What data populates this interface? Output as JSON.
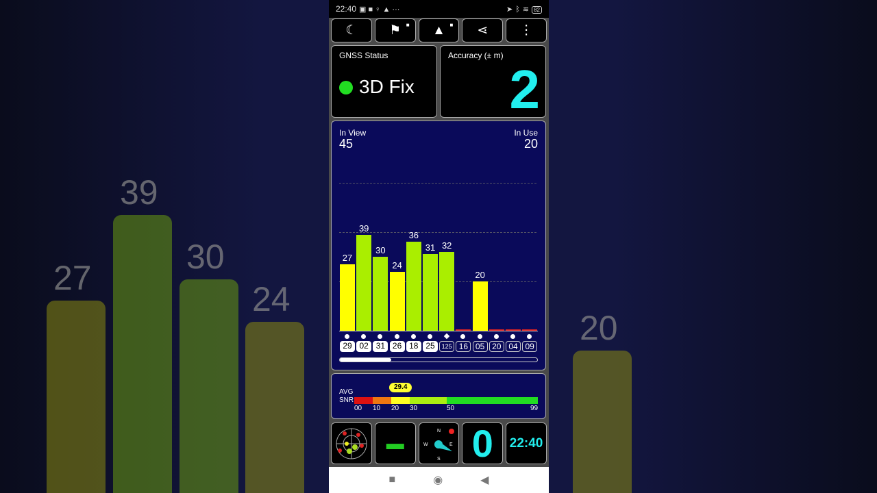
{
  "status_bar": {
    "time": "22:40",
    "battery": "82"
  },
  "toolbar": {
    "buttons": [
      {
        "icon": "moon-icon"
      },
      {
        "icon": "person-flag-icon",
        "locked": true
      },
      {
        "icon": "navigation-arrow-icon",
        "locked": true
      },
      {
        "icon": "share-icon"
      },
      {
        "icon": "more-vert-icon"
      }
    ]
  },
  "gnss": {
    "label": "GNSS Status",
    "value": "3D Fix",
    "status_color": "#22dd22"
  },
  "accuracy": {
    "label": "Accuracy (± m)",
    "value": "2",
    "color": "#22eeee"
  },
  "sats": {
    "in_view_label": "In View",
    "in_view": "45",
    "in_use_label": "In Use",
    "in_use": "20"
  },
  "chart_data": {
    "type": "bar",
    "categories": [
      "29",
      "02",
      "31",
      "26",
      "18",
      "25",
      "125",
      "16",
      "05",
      "20",
      "04",
      "09"
    ],
    "values": [
      27,
      39,
      30,
      24,
      36,
      31,
      32,
      0,
      20,
      0,
      0,
      0
    ],
    "in_use": [
      true,
      true,
      true,
      true,
      true,
      true,
      false,
      false,
      false,
      false,
      false,
      false
    ],
    "colors": [
      "#ffff00",
      "#aaee00",
      "#aaee00",
      "#ffff00",
      "#aaee00",
      "#aaee00",
      "#aaee00",
      "#dd2222",
      "#ffff00",
      "#dd2222",
      "#dd2222",
      "#dd2222"
    ],
    "gridlines": [
      20,
      40,
      60
    ],
    "scroll_fraction": 0.26
  },
  "snr": {
    "label1": "AVG",
    "label2": "SNR",
    "avg": "29.4",
    "avg_value": 29.4,
    "ticks": [
      "00",
      "10",
      "20",
      "30",
      "50",
      "99"
    ]
  },
  "bottom": {
    "count": "0",
    "clock": "22:40"
  }
}
